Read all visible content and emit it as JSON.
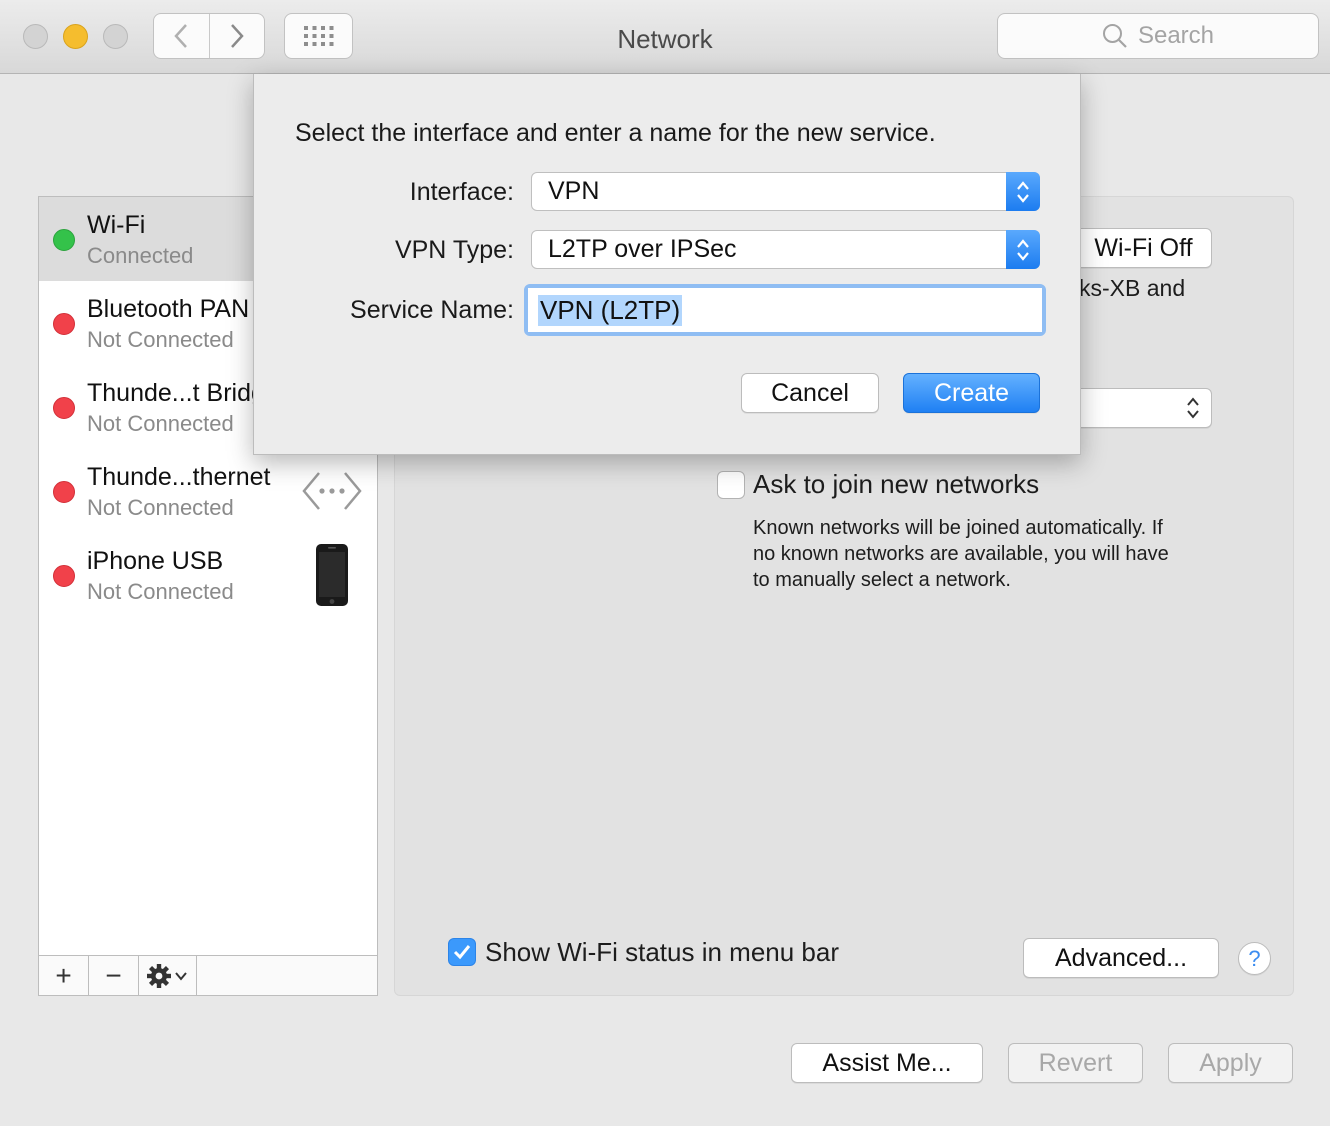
{
  "window": {
    "title": "Network",
    "search_placeholder": "Search"
  },
  "colors": {
    "accent": "#3b99fc",
    "connected": "#34c24a",
    "disconnected": "#f1414a"
  },
  "services": [
    {
      "name": "Wi-Fi",
      "status": "Connected",
      "state": "connected",
      "selected": true
    },
    {
      "name": "Bluetooth PAN",
      "status": "Not Connected",
      "state": "disconnected"
    },
    {
      "name": "Thunde...t Bridge",
      "status": "Not Connected",
      "state": "disconnected"
    },
    {
      "name": "Thunde...thernet",
      "status": "Not Connected",
      "state": "disconnected",
      "icon": "ethernet-arrows-icon"
    },
    {
      "name": "iPhone USB",
      "status": "Not Connected",
      "state": "disconnected",
      "icon": "iphone-icon"
    }
  ],
  "list_toolbar": {
    "add_label": "+",
    "remove_label": "−",
    "gear_icon": "gear-icon"
  },
  "panel": {
    "wifi_off_label": "Wi-Fi Off",
    "partial_text": "ks-XB and",
    "ask_join_label": "Ask to join new networks",
    "ask_join_checked": false,
    "ask_join_help_1": "Known networks will be joined automatically. If",
    "ask_join_help_2": "no known networks are available, you will have",
    "ask_join_help_3": "to manually select a network.",
    "show_status_label": "Show Wi-Fi status in menu bar",
    "show_status_checked": true,
    "advanced_label": "Advanced...",
    "help_label": "?"
  },
  "footer": {
    "assist_label": "Assist Me...",
    "revert_label": "Revert",
    "apply_label": "Apply"
  },
  "dialog": {
    "prompt": "Select the interface and enter a name for the new service.",
    "interface_label": "Interface:",
    "interface_value": "VPN",
    "vpn_type_label": "VPN Type:",
    "vpn_type_value": "L2TP over IPSec",
    "service_name_label": "Service Name:",
    "service_name_value": "VPN (L2TP)",
    "cancel_label": "Cancel",
    "create_label": "Create"
  }
}
